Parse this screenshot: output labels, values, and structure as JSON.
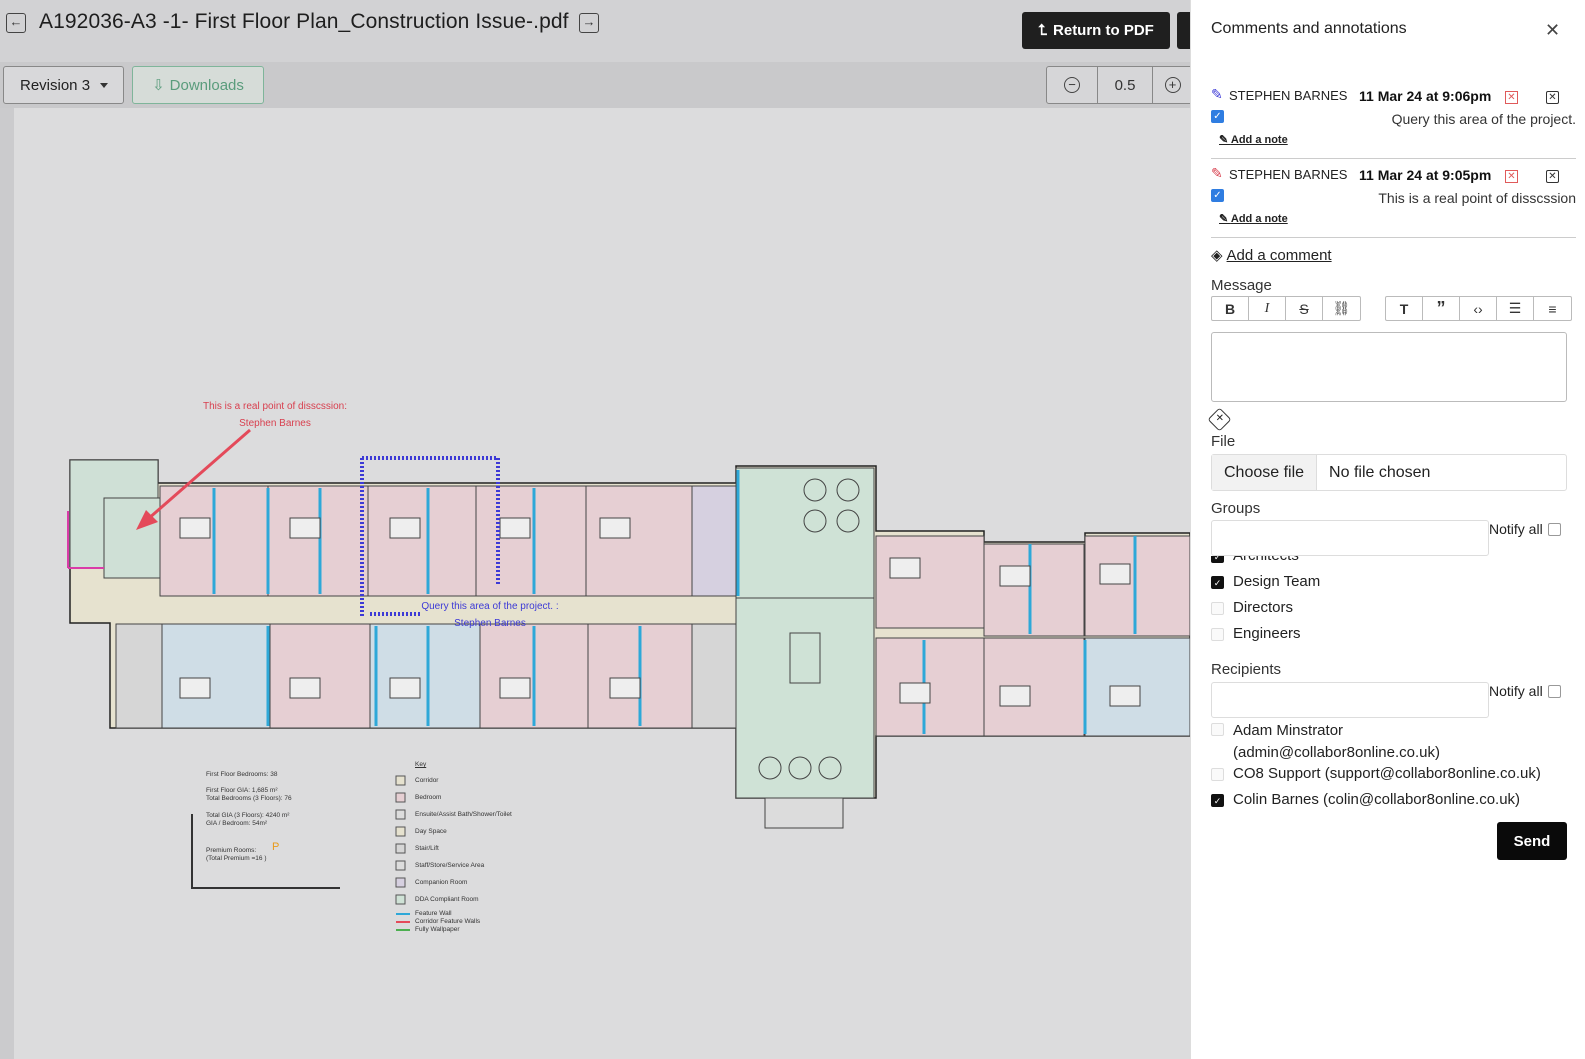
{
  "header": {
    "title": "A192036-A3 -1- First Floor Plan_Construction Issue-.pdf",
    "prev_icon": "arrow-left-icon",
    "next_icon": "arrow-right-icon",
    "return_label": "Return to PDF"
  },
  "toolbar": {
    "revision_label": "Revision 3",
    "downloads_label": "Downloads",
    "zoom_value": "0.5"
  },
  "drawing": {
    "annotation_red": "This is a real point of disscssion: Stephen Barnes",
    "annotation_blue": "Query this area of the project. : Stephen Barnes",
    "stats": [
      "First Floor Bedrooms: 38",
      "First Floor GIA: 1,685 m²",
      "Total Bedrooms (3 Floors): 76",
      "Total GIA (3 Floors): 4240 m²",
      "GIA / Bedroom: 54m²",
      "Premium Rooms:",
      "(Total Premium =16 )"
    ],
    "premium_mark": "P",
    "key_title": "Key",
    "key_items": [
      "Corridor",
      "Bedroom",
      "Ensuite/Assist Bath/Shower/Toilet",
      "Day Space",
      "Stair/Lift",
      "Staff/Store/Service Area",
      "Companion Room",
      "DDA Compliant Room"
    ],
    "wall_items": [
      "Feature Wall",
      "Corridor Feature Walls",
      "Fully Wallpaper"
    ]
  },
  "panel": {
    "title": "Comments and annotations",
    "comments": [
      {
        "author": "STEPHEN BARNES",
        "date": "11 Mar 24 at 9:06pm",
        "text": "Query this area of the project.",
        "note_label": "Add a note",
        "pen_color": "#3d3ad6"
      },
      {
        "author": "STEPHEN BARNES",
        "date": "11 Mar 24 at 9:05pm",
        "text": "This is a real point of disscssion",
        "note_label": "Add a note",
        "pen_color": "#d8404f"
      }
    ],
    "add_comment_label": "Add a comment",
    "message_label": "Message",
    "file_label": "File",
    "choose_file_label": "Choose file",
    "no_file_label": "No file chosen",
    "groups_label": "Groups",
    "notify_all_label": "Notify all",
    "groups": [
      {
        "label": "Architects",
        "checked": true
      },
      {
        "label": "Design Team",
        "checked": true
      },
      {
        "label": "Directors",
        "checked": false
      },
      {
        "label": "Engineers",
        "checked": false
      }
    ],
    "recipients_label": "Recipients",
    "recipients": [
      {
        "label": "Adam Minstrator (admin@collabor8online.co.uk)",
        "checked": false
      },
      {
        "label": "CO8 Support (support@collabor8online.co.uk)",
        "checked": false
      },
      {
        "label": "Colin Barnes (colin@collabor8online.co.uk)",
        "checked": true
      }
    ],
    "send_label": "Send"
  }
}
